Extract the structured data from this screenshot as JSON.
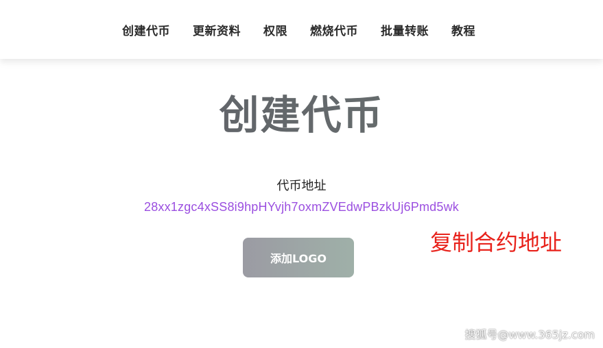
{
  "nav": {
    "items": [
      {
        "label": "创建代币"
      },
      {
        "label": "更新资料"
      },
      {
        "label": "权限"
      },
      {
        "label": "燃烧代币"
      },
      {
        "label": "批量转账"
      },
      {
        "label": "教程"
      }
    ]
  },
  "main": {
    "title": "创建代币",
    "address_label": "代币地址",
    "address_value": "28xx1zgc4xSS8i9hpHYvjh7oxmZVEdwPBzkUj6Pmd5wk",
    "add_logo_label": "添加LOGO"
  },
  "annotation": {
    "text": "复制合约地址"
  },
  "watermark": {
    "text": "搜狐号@www.365jz.com"
  },
  "colors": {
    "address": "#9b4fe0",
    "annotation": "#e8221b",
    "button_start": "#9b9ba3",
    "button_end": "#9fb0a8"
  }
}
